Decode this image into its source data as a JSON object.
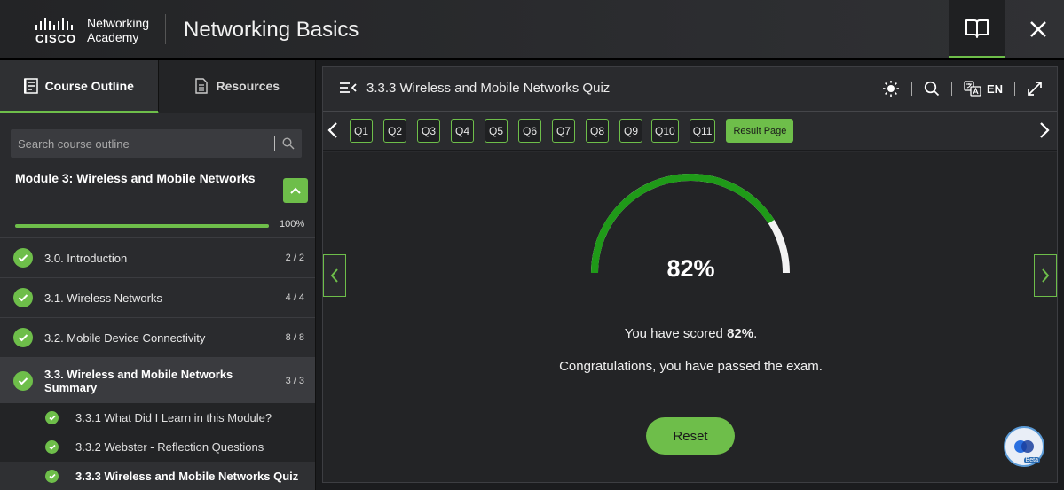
{
  "header": {
    "brand_name": "CISCO",
    "brand_product": "Networking",
    "brand_product_sub": "Academy",
    "course_title": "Networking Basics",
    "icons": [
      "book-icon",
      "close-icon"
    ]
  },
  "sidebar": {
    "tabs": [
      {
        "label": "Course Outline",
        "icon": "outline-icon",
        "active": true
      },
      {
        "label": "Resources",
        "icon": "document-icon",
        "active": false
      }
    ],
    "search_placeholder": "Search course outline",
    "module": {
      "title": "Module 3: Wireless and Mobile Networks",
      "progress_pct": 100,
      "progress_text": "100%"
    },
    "items": [
      {
        "label": "3.0. Introduction",
        "count": "2 / 2",
        "done": true
      },
      {
        "label": "3.1. Wireless Networks",
        "count": "4 / 4",
        "done": true
      },
      {
        "label": "3.2. Mobile Device Connectivity",
        "count": "8 / 8",
        "done": true
      },
      {
        "label": "3.3. Wireless and Mobile Networks Summary",
        "count": "3 / 3",
        "done": true,
        "active": true
      }
    ],
    "subitems": [
      {
        "label": "3.3.1 What Did I Learn in this Module?"
      },
      {
        "label": "3.3.2 Webster - Reflection Questions"
      },
      {
        "label": "3.3.3 Wireless and Mobile Networks Quiz",
        "current": true
      }
    ]
  },
  "main": {
    "title": "3.3.3 Wireless and Mobile Networks Quiz",
    "language": "EN",
    "questions": [
      "Q1",
      "Q2",
      "Q3",
      "Q4",
      "Q5",
      "Q6",
      "Q7",
      "Q8",
      "Q9",
      "Q10",
      "Q11"
    ],
    "result_label": "Result Page",
    "score_pct": 82,
    "score_text": "82%",
    "scored_prefix": "You have scored ",
    "scored_value": "82%",
    "scored_suffix": ".",
    "message": "Congratulations, you have passed the exam.",
    "reset_label": "Reset",
    "assistant_badge": "Beta",
    "colors": {
      "accent": "#6ebe4a",
      "gauge_fill": "#1f9a18",
      "gauge_track": "#f2f2f2"
    }
  }
}
